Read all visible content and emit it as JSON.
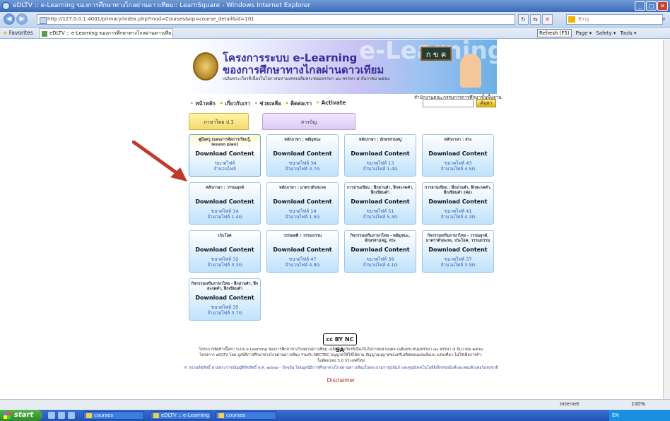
{
  "window": {
    "title": "eDLTV :: e-Learning ของการศึกษาทางไกลผ่านดาวเทียม:: LearnSquare - Windows Internet Explorer",
    "buttons": [
      "_",
      "□",
      "✕"
    ]
  },
  "address_bar": {
    "url": "http://127.0.0.1:4001/primary/index.php?mod=Courses&op=course_detail&id=101",
    "search_placeholder": "Bing",
    "icons": [
      "refresh-icon",
      "compat-icon",
      "stop-icon"
    ]
  },
  "favorites_bar": {
    "favorites_label": "Favorites",
    "tab_title": "eDLTV :: e-Learning ของการศึกษาทางไกลผ่านดาวเทีย...",
    "commands": [
      "Refresh (F5)",
      "Page ▾",
      "Safety ▾",
      "Tools ▾"
    ]
  },
  "banner": {
    "line1": "โครงการระบบ e-Learning",
    "line2": "ของการศึกษาทางไกลผ่านดาวเทียม",
    "line3": "เฉลิมพระเกียรติเนื่องในโอกาสมหามงคลเฉลิมพระชนมพรรษา ๘๐ พรรษา ๕ ธันวาคม ๒๕๕๐",
    "deco": "e-Learning",
    "board": "ก ข ค"
  },
  "org_line": "สำนักงานคณะกรรมการการศึกษาขั้นพื้นฐาน",
  "nav": {
    "items": [
      "หน้าหลัก",
      "เกี่ยวกับเรา",
      "ช่วยเหลือ",
      "ติดต่อเรา",
      "Activate"
    ],
    "search_button": "ค้นหา"
  },
  "tabs": {
    "active": "ภาษาไทย ป.1",
    "other": "สารบัญ"
  },
  "cards": [
    {
      "title": "คู่มือครู [แผนการจัดการเรียนรู้, lesson plan]",
      "button": "Download Content",
      "size": "ขนาดไฟล์",
      "count": "จำนวนไฟล์"
    },
    {
      "title": "หลักภาษา : พยัญชนะ",
      "button": "Download Content",
      "size": "ขนาดไฟล์ 34",
      "count": "จำนวนไฟล์ 3.7G"
    },
    {
      "title": "หลักภาษา : อักษรสามหมู่",
      "button": "Download Content",
      "size": "ขนาดไฟล์ 13",
      "count": "จำนวนไฟล์ 1.4G"
    },
    {
      "title": "หลักภาษา : สระ",
      "button": "Download Content",
      "size": "ขนาดไฟล์ 43",
      "count": "จำนวนไฟล์ 4.5G"
    },
    {
      "title": "หลักภาษา : วรรณยุกต์",
      "button": "Download Content",
      "size": "ขนาดไฟล์ 14",
      "count": "จำนวนไฟล์ 1.4G"
    },
    {
      "title": "หลักภาษา : มาตราตัวสะกด",
      "button": "Download Content",
      "size": "ขนาดไฟล์ 14",
      "count": "จำนวนไฟล์ 1.5G"
    },
    {
      "title": "การอ่านเขียน : ฝึกอ่านคำ, ฝึกสะกดคำ, ฝึกเขียนคำ",
      "button": "Download Content",
      "size": "ขนาดไฟล์ 51",
      "count": "จำนวนไฟล์ 5.3G"
    },
    {
      "title": "การอ่านเขียน : ฝึกอ่านคำ, ฝึกสะกดคำ, ฝึกเขียนคำ (ต่อ)",
      "button": "Download Content",
      "size": "ขนาดไฟล์ 41",
      "count": "จำนวนไฟล์ 4.3G"
    },
    {
      "title": "ประโยค",
      "button": "Download Content",
      "size": "ขนาดไฟล์ 32",
      "count": "จำนวนไฟล์ 3.3G"
    },
    {
      "title": "วรรณคดี / วรรณกรรม",
      "button": "Download Content",
      "size": "ขนาดไฟล์ 47",
      "count": "จำนวนไฟล์ 4.9G"
    },
    {
      "title": "กิจกรรมเสริมภาษาไทย - พยัญชนะ, อักษรสามหมู่, สระ",
      "button": "Download Content",
      "size": "ขนาดไฟล์ 39",
      "count": "จำนวนไฟล์ 4.1G"
    },
    {
      "title": "กิจกรรมเสริมภาษาไทย - วรรณยุกต์, มาตราตัวสะกด, ประโยค, วรรณกรรม",
      "button": "Download Content",
      "size": "ขนาดไฟล์ 37",
      "count": "จำนวนไฟล์ 3.9G"
    },
    {
      "title": "กิจกรรมเสริมภาษาไทย - ฝึกอ่านคำ, ฝึกสะกดคำ, ฝึกเขียนคำ",
      "button": "Download Content",
      "size": "ขนาดไฟล์ 35",
      "count": "จำนวนไฟล์ 3.7G"
    }
  ],
  "footer": {
    "cc_badge": "cc BY NC SA",
    "line1": "โครงการจัดทำเนื้อหา ระบบ e-Learning ของการศึกษาทางไกลผ่านดาวเทียม เฉลิมพระเกียรติเนื่องในโอกาสมหามงคล เฉลิมพระชนมพรรษา ๘๐ พรรษา ๕ ธันวาคม ๒๕๕๐",
    "line2": "โครงการ eDLTV โดย มูลนิธิการศึกษาทางไกลผ่านดาวเทียม ร่วมกับ NECTEC อนุญาตให้ใช้ได้ตาม สัญญาอนุญาตของครีเอทีฟคอมมอนส์แบบ แสดงที่มา-ไม่ใช้เพื่อการค้า-",
    "line3": "ไม่ดัดแปลง 3.0 ประเทศไทย",
    "copyright": "© สงวนลิขสิทธิ์ ตามพระราชบัญญัติลิขสิทธิ์ พ.ศ. ๒๕๓๗ – ปัจจุบัน โดยมูลนิธิการศึกษาทางไกลผ่านดาวเทียมในพระบรมราชูปถัมภ์ และศูนย์เทคโนโลยีอิเล็กทรอนิกส์และคอมพิวเตอร์แห่งชาติ",
    "disclaimer": "Disclaimer"
  },
  "statusbar": {
    "zone": "Internet",
    "zoom": "100%"
  },
  "taskbar": {
    "start": "start",
    "tasks": [
      "courses",
      "eDLTV :: e-Learning ...",
      "courses"
    ],
    "tray": "EN"
  },
  "colors": {
    "accent_arrow": "#c0392b",
    "card_blue": "#bfe2fb",
    "tab_yellow": "#f3d96e",
    "tab_purple": "#dccaf6"
  }
}
